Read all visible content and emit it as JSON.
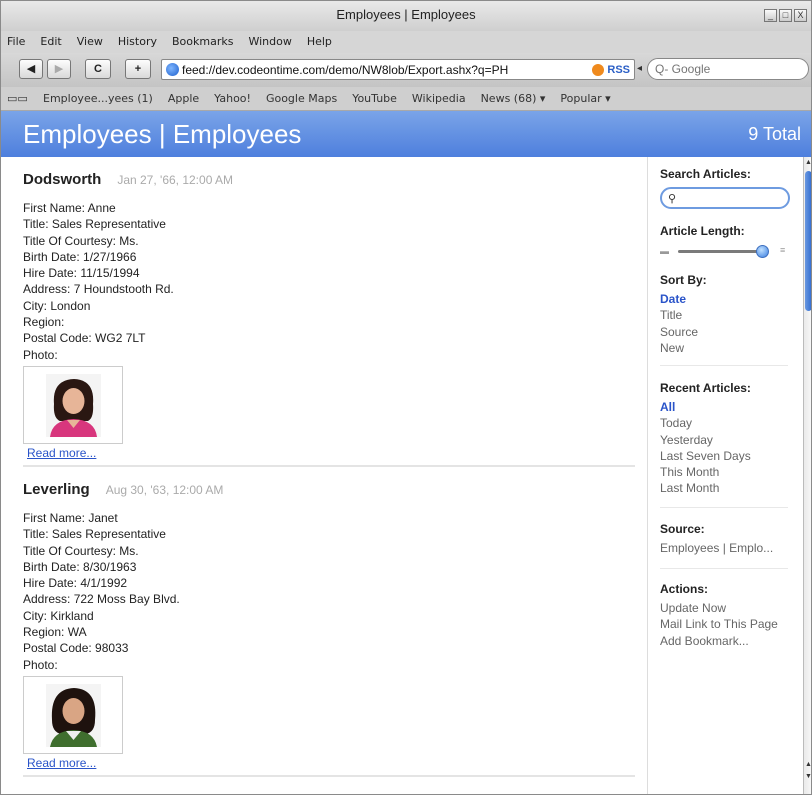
{
  "window": {
    "title": "Employees | Employees",
    "controls": [
      "_",
      "□",
      "X"
    ]
  },
  "menu": [
    "File",
    "Edit",
    "View",
    "History",
    "Bookmarks",
    "Window",
    "Help"
  ],
  "toolbar": {
    "back": "◀",
    "forward": "▶",
    "reload": "C",
    "add": "+",
    "url": "feed://dev.codeontime.com/demo/NW8lob/Export.ashx?q=PH",
    "rss": "RSS",
    "search_placeholder": "Q- Google"
  },
  "bookmarks": [
    "Employee...yees (1)",
    "Apple",
    "Yahoo!",
    "Google Maps",
    "YouTube",
    "Wikipedia",
    "News (68) ▾",
    "Popular ▾"
  ],
  "feed": {
    "title": "Employees | Employees",
    "total": "9 Total"
  },
  "articles": [
    {
      "name": "Dodsworth",
      "date": "Jan 27, '66, 12:00 AM",
      "fields": [
        "First Name: Anne",
        "Title: Sales Representative",
        "Title Of Courtesy: Ms.",
        "Birth Date: 1/27/1966",
        "Hire Date: 11/15/1994",
        "Address: 7 Houndstooth Rd.",
        "City: London",
        "Region:",
        "Postal Code: WG2 7LT",
        "Photo:"
      ],
      "read_more": "Read more..."
    },
    {
      "name": "Leverling",
      "date": "Aug 30, '63, 12:00 AM",
      "fields": [
        "First Name: Janet",
        "Title: Sales Representative",
        "Title Of Courtesy: Ms.",
        "Birth Date: 8/30/1963",
        "Hire Date: 4/1/1992",
        "Address: 722 Moss Bay Blvd.",
        "City: Kirkland",
        "Region: WA",
        "Postal Code: 98033",
        "Photo:"
      ],
      "read_more": "Read more..."
    }
  ],
  "sidebar": {
    "search_heading": "Search Articles:",
    "length_heading": "Article Length:",
    "length_level": 1.0,
    "sort_heading": "Sort By:",
    "sort_options": [
      "Date",
      "Title",
      "Source",
      "New"
    ],
    "recent_heading": "Recent Articles:",
    "recent_options": [
      "All",
      "Today",
      "Yesterday",
      "Last Seven Days",
      "This Month",
      "Last Month"
    ],
    "source_heading": "Source:",
    "source_value": "Employees | Emplo...",
    "actions_heading": "Actions:",
    "actions": [
      "Update Now",
      "Mail Link to This Page",
      "Add Bookmark..."
    ]
  },
  "colors": {
    "accent": "#4e7fdd",
    "link": "#2a54c9",
    "date": "#aaaaaa"
  }
}
